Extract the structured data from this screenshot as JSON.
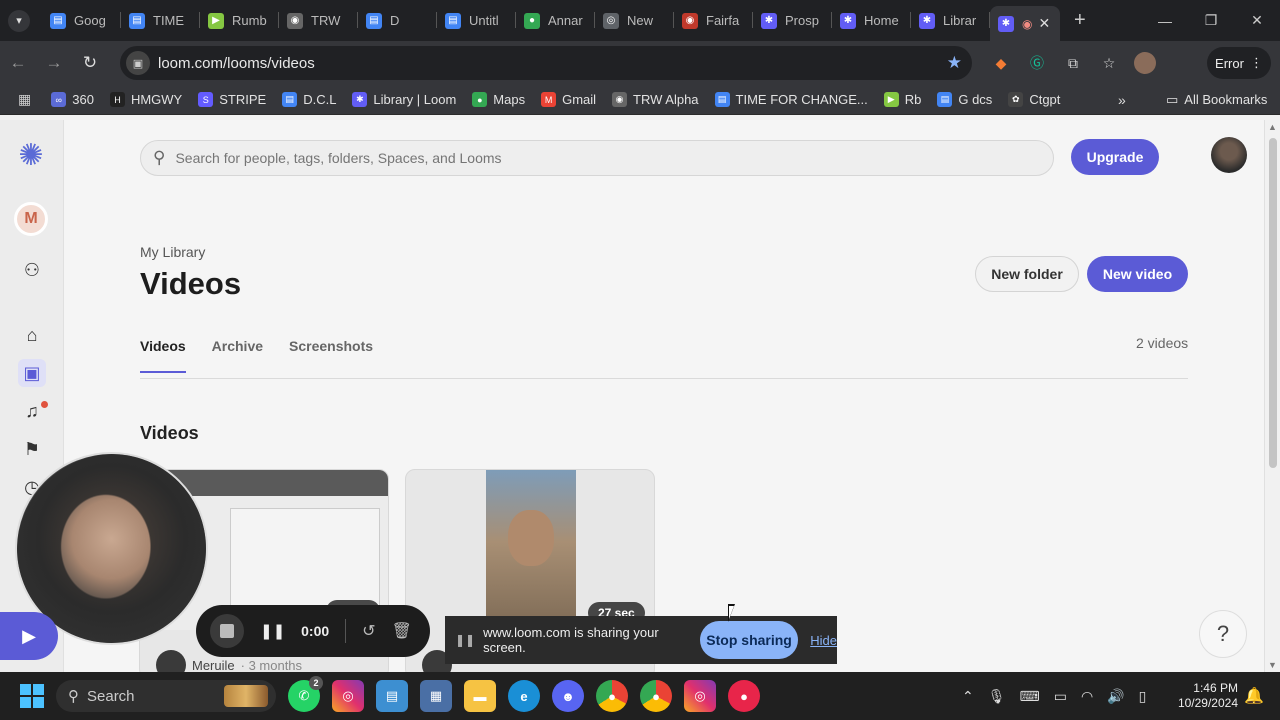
{
  "browser": {
    "tabs": [
      {
        "label": "Goog",
        "icon": "google-docs-icon",
        "color": "#4285f4"
      },
      {
        "label": "TIME",
        "icon": "docs-icon",
        "color": "#4285f4"
      },
      {
        "label": "Rumb",
        "icon": "rumble-icon",
        "color": "#85c742"
      },
      {
        "label": "TRW",
        "icon": "trw-icon",
        "color": "#999999"
      },
      {
        "label": "D",
        "icon": "docs-pin-icon",
        "color": "#4285f4"
      },
      {
        "label": "Untitl",
        "icon": "docs-icon",
        "color": "#4285f4"
      },
      {
        "label": "Annar",
        "icon": "maps-icon",
        "color": "#34a853"
      },
      {
        "label": "New",
        "icon": "chrome-icon",
        "color": "#dddddd"
      },
      {
        "label": "Fairfa",
        "icon": "fairfax-icon",
        "color": "#c0392b"
      },
      {
        "label": "Prosp",
        "icon": "loom-icon",
        "color": "#625df5"
      },
      {
        "label": "Home",
        "icon": "loom-icon",
        "color": "#625df5"
      },
      {
        "label": "Librar",
        "icon": "loom-icon",
        "color": "#625df5"
      }
    ],
    "url": "loom.com/looms/videos",
    "error_label": "Error",
    "bookmarks": [
      {
        "label": "360",
        "color": "#5b6bd6"
      },
      {
        "label": "HMGWY",
        "color": "#222222"
      },
      {
        "label": "STRIPE",
        "color": "#635bff"
      },
      {
        "label": "D.C.L",
        "color": "#4285f4"
      },
      {
        "label": "Library | Loom",
        "color": "#625df5"
      },
      {
        "label": "Maps",
        "color": "#34a853"
      },
      {
        "label": "Gmail",
        "color": "#ea4335"
      },
      {
        "label": "TRW Alpha",
        "color": "#999999"
      },
      {
        "label": "TIME FOR CHANGE...",
        "color": "#4285f4"
      },
      {
        "label": "Rb",
        "color": "#85c742"
      },
      {
        "label": "G dcs",
        "color": "#4285f4"
      },
      {
        "label": "Ctgpt",
        "color": "#444444"
      }
    ],
    "all_bookmarks": "All Bookmarks"
  },
  "sidebar": {
    "workspace_initial": "M"
  },
  "header": {
    "search_placeholder": "Search for people, tags, folders, Spaces, and Looms",
    "upgrade_label": "Upgrade"
  },
  "main": {
    "breadcrumb": "My Library",
    "title": "Videos",
    "new_folder_label": "New folder",
    "new_video_label": "New video",
    "tabs": [
      {
        "label": "Videos",
        "active": true
      },
      {
        "label": "Archive",
        "active": false
      },
      {
        "label": "Screenshots",
        "active": false
      }
    ],
    "video_count": "2 videos",
    "section_title": "Videos",
    "cards": [
      {
        "owner": "Meruile",
        "time": "· 3 months",
        "duration": ""
      },
      {
        "owner": "",
        "time": "",
        "duration": "27 sec"
      }
    ]
  },
  "recorder": {
    "timer": "0:00"
  },
  "sharebar": {
    "message": "www.loom.com is sharing your screen.",
    "stop_label": "Stop sharing",
    "hide_label": "Hide"
  },
  "taskbar": {
    "search_label": "Search",
    "whatsapp_badge": "2",
    "time": "1:46 PM",
    "date": "10/29/2024"
  },
  "colors": {
    "accent": "#5b5bd6",
    "share_button": "#8ab4f8"
  }
}
